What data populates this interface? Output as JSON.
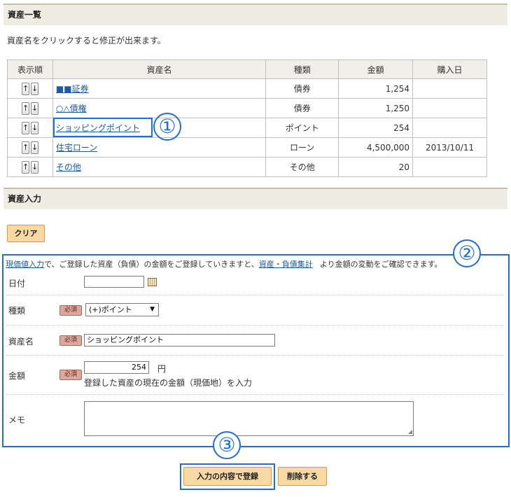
{
  "section_list": {
    "title": "資産一覧",
    "description": "資産名をクリックすると修正が出来ます。"
  },
  "table": {
    "headers": [
      "表示順",
      "資産名",
      "種類",
      "金額",
      "購入日"
    ],
    "rows": [
      {
        "name": "■■証券",
        "type": "債券",
        "amount": "1,254",
        "date": ""
      },
      {
        "name": "○△債権",
        "type": "債券",
        "amount": "1,250",
        "date": ""
      },
      {
        "name": "ショッピングポイント",
        "type": "ポイント",
        "amount": "254",
        "date": ""
      },
      {
        "name": "住宅ローン",
        "type": "ローン",
        "amount": "4,500,000",
        "date": "2013/10/11"
      },
      {
        "name": "その他",
        "type": "その他",
        "amount": "20",
        "date": ""
      }
    ],
    "up_arrow": "↑",
    "down_arrow": "↓"
  },
  "section_input": {
    "title": "資産入力",
    "clear_label": "クリア"
  },
  "info": {
    "link1": "現価値入力",
    "text1": "で、ご登録した資産（負債）の金額をご登録していきますと、",
    "link2": "資産・負債集計",
    "text2": "より金額の変動をご確認できます。"
  },
  "form": {
    "required_label": "必須",
    "date_label": "日付",
    "date_value": "",
    "type_label": "種類",
    "type_value": "(+)ポイント",
    "type_caret": "▼",
    "name_label": "資産名",
    "name_value": "ショッピングポイント",
    "amount_label": "金額",
    "amount_value": "254",
    "amount_unit": "円",
    "amount_hint": "登録した資産の現在の金額（現価地）を入力",
    "memo_label": "メモ",
    "memo_value": ""
  },
  "buttons": {
    "register": "入力の内容で登録",
    "delete": "削除する"
  },
  "annotations": {
    "one": "①",
    "two": "②",
    "three": "③"
  },
  "colors": {
    "accent_blue": "#1f6fd2",
    "button_orange": "#f8d9a3",
    "section_bg": "#efece4",
    "required_badge": "#d9a9a0"
  }
}
